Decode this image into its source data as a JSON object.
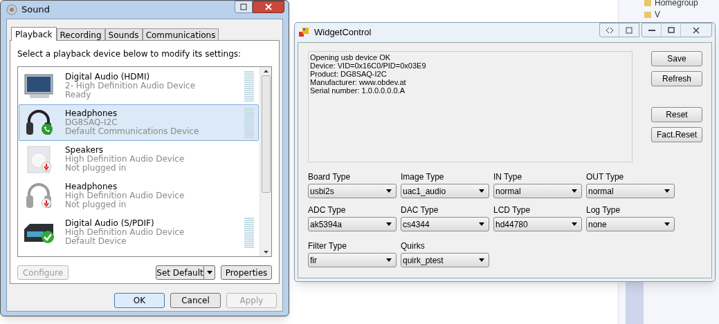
{
  "background": {
    "nav_items": [
      "Homegroup",
      "V"
    ]
  },
  "sound_window": {
    "title": "Sound",
    "tabs": [
      {
        "label": "Playback",
        "selected": true
      },
      {
        "label": "Recording",
        "selected": false
      },
      {
        "label": "Sounds",
        "selected": false
      },
      {
        "label": "Communications",
        "selected": false
      }
    ],
    "instruction": "Select a playback device below to modify its settings:",
    "devices": [
      {
        "kind": "monitor",
        "name": "Digital Audio (HDMI)",
        "description": "2- High Definition Audio Device",
        "status": "Ready",
        "disabled": false,
        "meter": true,
        "selected": false
      },
      {
        "kind": "headphones",
        "name": "Headphones",
        "description": "DG8SAQ-I2C",
        "status": "Default Communications Device",
        "badge": {
          "kind": "phone"
        },
        "disabled": false,
        "meter": true,
        "selected": true
      },
      {
        "kind": "speaker",
        "name": "Speakers",
        "description": "High Definition Audio Device",
        "status": "Not plugged in",
        "badge": {
          "kind": "unplugged"
        },
        "disabled": true,
        "meter": false,
        "selected": false
      },
      {
        "kind": "headphones",
        "name": "Headphones",
        "description": "High Definition Audio Device",
        "status": "Not plugged in",
        "badge": {
          "kind": "unplugged"
        },
        "disabled": true,
        "meter": false,
        "selected": false
      },
      {
        "kind": "receiver",
        "name": "Digital Audio (S/PDIF)",
        "description": "High Definition Audio Device",
        "status": "Default Device",
        "badge": {
          "kind": "check"
        },
        "disabled": false,
        "meter": true,
        "selected": false
      }
    ],
    "buttons": [
      {
        "label": "Configure",
        "disabled": true
      },
      {
        "label": "Set Default",
        "disabled": false
      },
      {
        "label": "Properties",
        "disabled": false
      }
    ],
    "footer_buttons": [
      {
        "label": "OK",
        "disabled": false,
        "default": true
      },
      {
        "label": "Cancel",
        "disabled": false,
        "default": false
      },
      {
        "label": "Apply",
        "disabled": true,
        "default": false
      }
    ]
  },
  "widget_window": {
    "title": "WidgetControl",
    "log_lines": [
      "Opening usb device OK",
      "Device: VID=0x16C0/PID=0x03E9",
      "Product: DG8SAQ-I2C",
      "Manufacturer: www.obdev.at",
      "Serial number: 1.0.0.0.0.0.A"
    ],
    "buttons": [
      {
        "label": "Save"
      },
      {
        "label": "Refresh"
      },
      {
        "label": "Reset"
      },
      {
        "label": "Fact.Reset"
      }
    ],
    "fields": [
      {
        "label": "Board Type",
        "value": "usbi2s"
      },
      {
        "label": "Image Type",
        "value": "uac1_audio"
      },
      {
        "label": "IN Type",
        "value": "normal"
      },
      {
        "label": "OUT Type",
        "value": "normal"
      },
      {
        "label": "ADC Type",
        "value": "ak5394a"
      },
      {
        "label": "DAC Type",
        "value": "cs4344"
      },
      {
        "label": "LCD Type",
        "value": "hd44780"
      },
      {
        "label": "Log Type",
        "value": "none"
      },
      {
        "label": "Filter Type",
        "value": "fir"
      },
      {
        "label": "Quirks",
        "value": "quirk_ptest"
      }
    ]
  }
}
